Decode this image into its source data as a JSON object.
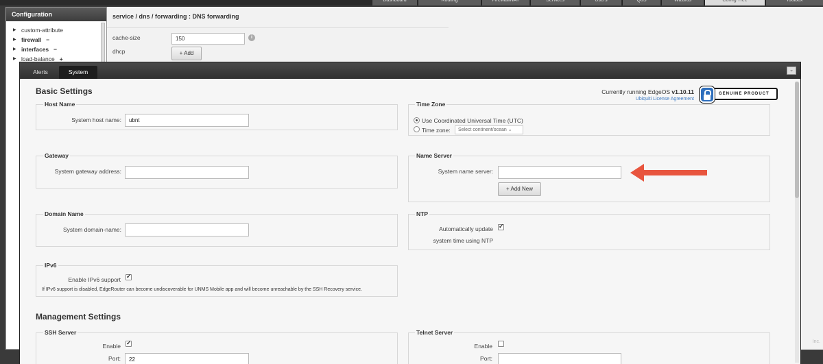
{
  "topnav": {
    "tabs": [
      "Dashboard",
      "Routing",
      "Firewall/NAT",
      "Services",
      "Users",
      "QoS",
      "Wizards",
      "Config Tree",
      "Toolbox"
    ]
  },
  "config": {
    "title": "Configuration",
    "tree": [
      {
        "label": "custom-attribute",
        "bold": false,
        "sign": ""
      },
      {
        "label": "firewall",
        "bold": true,
        "sign": "−"
      },
      {
        "label": "interfaces",
        "bold": true,
        "sign": "−"
      },
      {
        "label": "load-balance",
        "bold": false,
        "sign": "+"
      }
    ]
  },
  "bg": {
    "breadcrumb": "service / dns / forwarding : DNS forwarding",
    "cache_size_label": "cache-size",
    "cache_size_value": "150",
    "dhcp_label": "dhcp",
    "add_label": "Add",
    "copyright": "Inc."
  },
  "window": {
    "tabs": {
      "alerts": "Alerts",
      "system": "System"
    },
    "collapse_glyph": "⌄"
  },
  "basic": {
    "title": "Basic Settings",
    "running_prefix": "Currently running EdgeOS",
    "version": "v1.10.11",
    "license_link": "Ubiquiti License Agreement",
    "badge_text": "GENUINE PRODUCT",
    "host": {
      "legend": "Host Name",
      "label": "System host name:",
      "value": "ubnt"
    },
    "timezone": {
      "legend": "Time Zone",
      "utc_label": "Use Coordinated Universal Time (UTC)",
      "tz_label": "Time zone:",
      "select_placeholder": "Select continent/ocean"
    },
    "gateway": {
      "legend": "Gateway",
      "label": "System gateway address:",
      "value": ""
    },
    "nameserver": {
      "legend": "Name Server",
      "label": "System name server:",
      "value": "",
      "add_label": "Add New"
    },
    "domain": {
      "legend": "Domain Name",
      "label": "System domain-name:",
      "value": ""
    },
    "ntp": {
      "legend": "NTP",
      "label_line1": "Automatically update",
      "label_line2": "system time using NTP",
      "checked": true
    },
    "ipv6": {
      "legend": "IPv6",
      "label": "Enable IPv6 support",
      "checked": true,
      "note": "If IPv6 support is disabled, EdgeRouter can become undiscoverable for UNMS Mobile app and will become unreachable by the SSH Recovery service."
    }
  },
  "management": {
    "title": "Management Settings",
    "ssh": {
      "legend": "SSH Server",
      "enable_label": "Enable",
      "enabled": true,
      "port_label": "Port:",
      "port_value": "22"
    },
    "telnet": {
      "legend": "Telnet Server",
      "enable_label": "Enable",
      "enabled": false,
      "port_label": "Port:",
      "port_value": ""
    }
  },
  "colors": {
    "arrow": "#e8553e",
    "link": "#3f7cc4",
    "system_tab": "#1e1e1e"
  }
}
